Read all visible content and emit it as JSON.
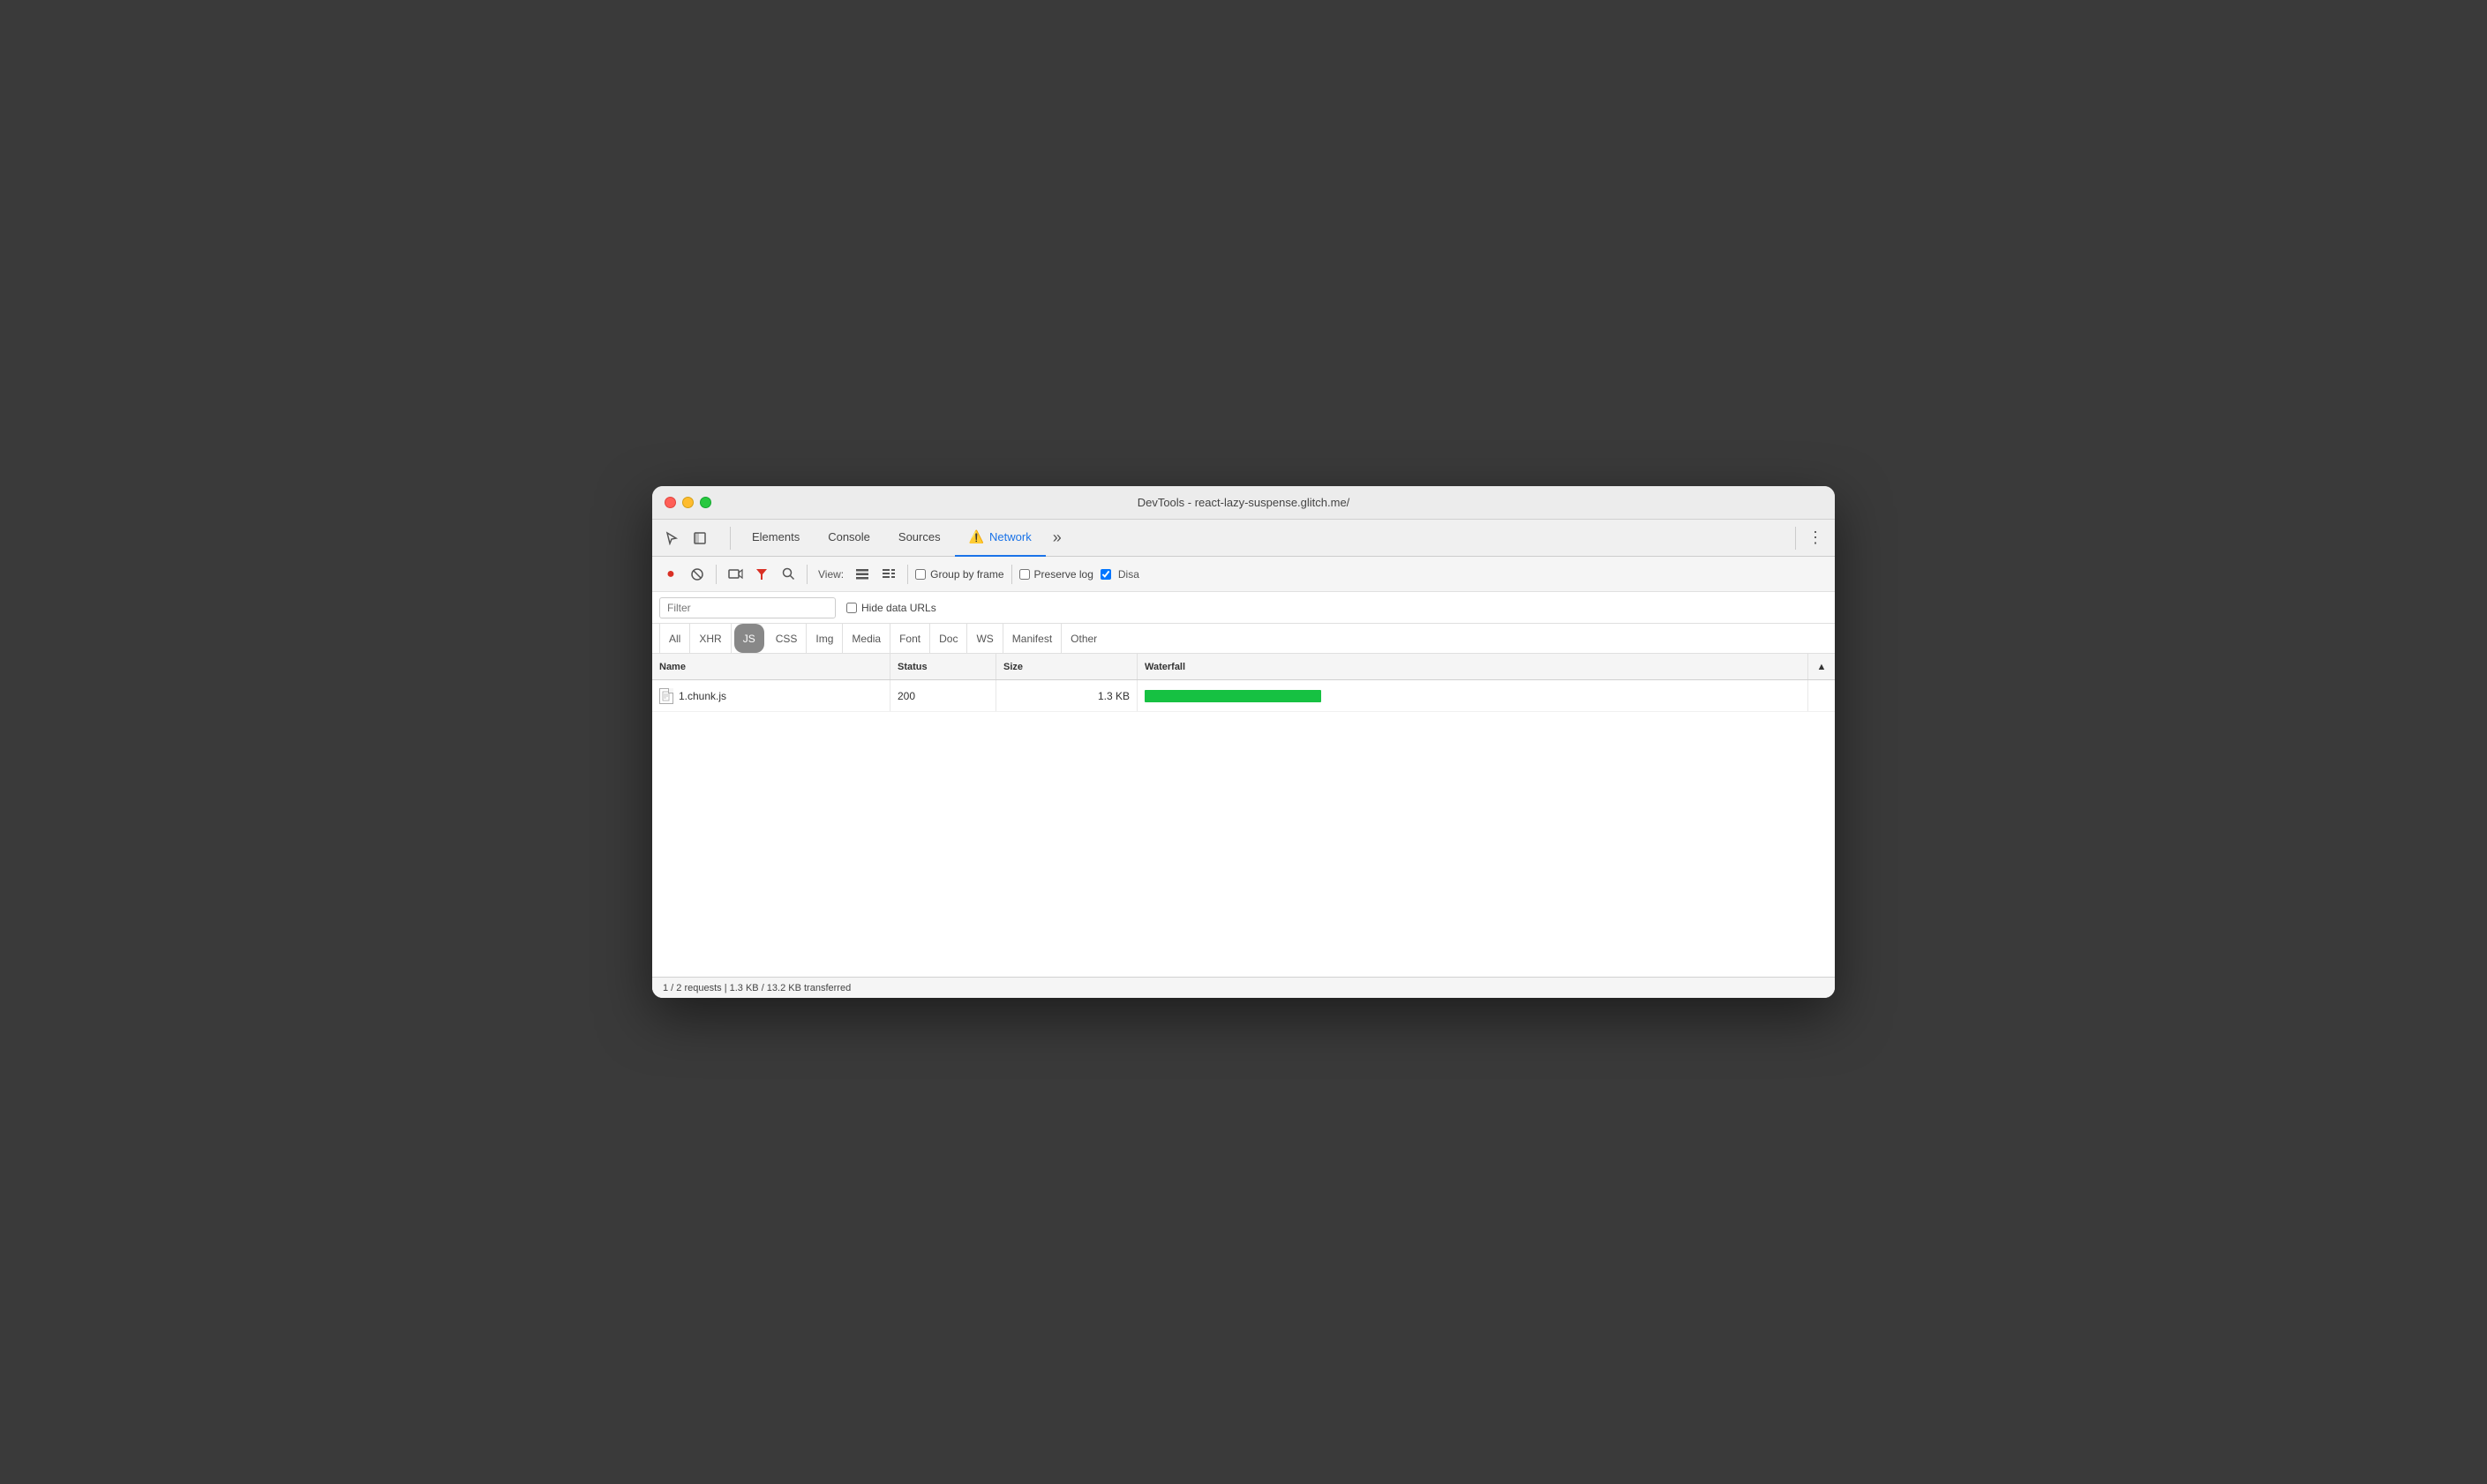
{
  "window": {
    "title": "DevTools - react-lazy-suspense.glitch.me/"
  },
  "tabs": {
    "items": [
      {
        "id": "elements",
        "label": "Elements",
        "active": false,
        "warning": false
      },
      {
        "id": "console",
        "label": "Console",
        "active": false,
        "warning": false
      },
      {
        "id": "sources",
        "label": "Sources",
        "active": false,
        "warning": false
      },
      {
        "id": "network",
        "label": "Network",
        "active": true,
        "warning": true
      },
      {
        "id": "more",
        "label": "»",
        "active": false,
        "warning": false
      }
    ]
  },
  "toolbar": {
    "view_label": "View:",
    "group_by_frame_label": "Group by frame",
    "preserve_log_label": "Preserve log",
    "disable_cache_label": "Disa"
  },
  "filter": {
    "placeholder": "Filter",
    "hide_data_urls_label": "Hide data URLs"
  },
  "type_filters": {
    "items": [
      {
        "id": "all",
        "label": "All",
        "active": false
      },
      {
        "id": "xhr",
        "label": "XHR",
        "active": false
      },
      {
        "id": "js",
        "label": "JS",
        "active": true
      },
      {
        "id": "css",
        "label": "CSS",
        "active": false
      },
      {
        "id": "img",
        "label": "Img",
        "active": false
      },
      {
        "id": "media",
        "label": "Media",
        "active": false
      },
      {
        "id": "font",
        "label": "Font",
        "active": false
      },
      {
        "id": "doc",
        "label": "Doc",
        "active": false
      },
      {
        "id": "ws",
        "label": "WS",
        "active": false
      },
      {
        "id": "manifest",
        "label": "Manifest",
        "active": false
      },
      {
        "id": "other",
        "label": "Other",
        "active": false
      }
    ]
  },
  "table": {
    "headers": [
      {
        "id": "name",
        "label": "Name"
      },
      {
        "id": "status",
        "label": "Status"
      },
      {
        "id": "size",
        "label": "Size"
      },
      {
        "id": "waterfall",
        "label": "Waterfall"
      },
      {
        "id": "sort",
        "label": "▲"
      }
    ],
    "rows": [
      {
        "name": "1.chunk.js",
        "status": "200",
        "size": "1.3 KB",
        "waterfall_width": 200,
        "waterfall_offset": 0
      }
    ]
  },
  "status_bar": {
    "text": "1 / 2 requests | 1.3 KB / 13.2 KB transferred"
  },
  "colors": {
    "active_tab": "#1a73e8",
    "record_red": "#d93025",
    "waterfall_green": "#16c142",
    "js_badge": "#888"
  }
}
